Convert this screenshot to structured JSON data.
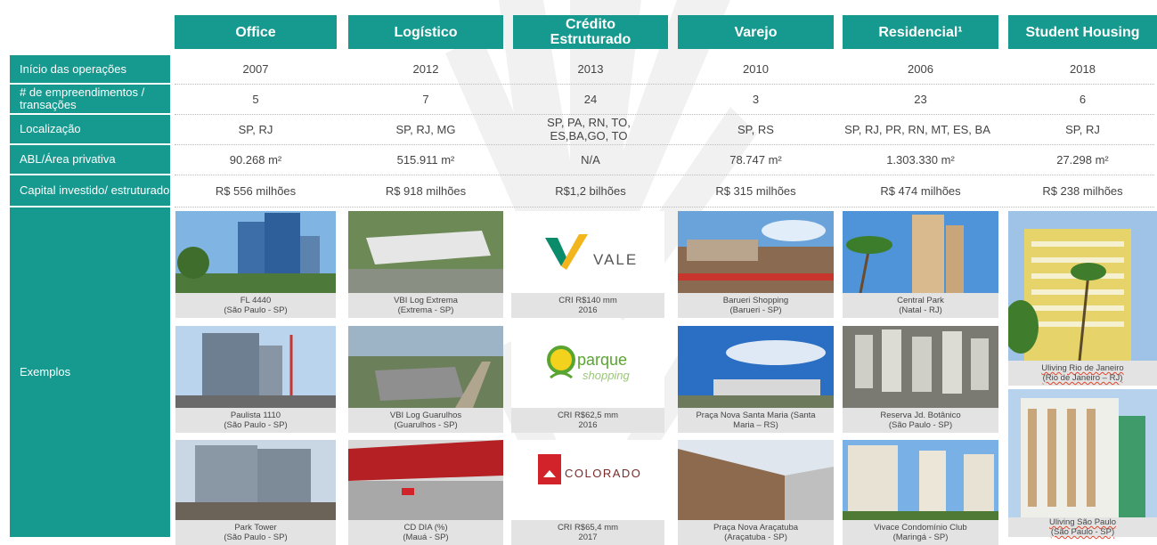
{
  "columns": [
    "Office",
    "Logístico",
    "Crédito Estruturado",
    "Varejo",
    "Residencial¹",
    "Student Housing"
  ],
  "rows": {
    "inicio": {
      "label": "Início das operações",
      "values": [
        "2007",
        "2012",
        "2013",
        "2010",
        "2006",
        "2018"
      ]
    },
    "empreendimentos": {
      "label": "# de empreendimentos / transações",
      "values": [
        "5",
        "7",
        "24",
        "3",
        "23",
        "6"
      ]
    },
    "localizacao": {
      "label": "Localização",
      "values": [
        "SP, RJ",
        "SP, RJ, MG",
        "SP, PA, RN, TO, ES,BA,GO, TO",
        "SP, RS",
        "SP, RJ, PR, RN, MT, ES, BA",
        "SP, RJ"
      ]
    },
    "abl": {
      "label": "ABL/Área privativa",
      "values": [
        "90.268 m²",
        "515.911 m²",
        "N/A",
        "78.747 m²",
        "1.303.330 m²",
        "27.298 m²"
      ]
    },
    "capital": {
      "label": "Capital investido/ estruturado",
      "values": [
        "R$ 556 milhões",
        "R$ 918 milhões",
        "R$1,2 bilhões",
        "R$ 315 milhões",
        "R$ 474 milhões",
        "R$ 238 milhões"
      ]
    },
    "exemplos": {
      "label": "Exemplos"
    }
  },
  "examples": {
    "office": [
      {
        "line1": "FL 4440",
        "line2": "(São Paulo - SP)"
      },
      {
        "line1": "Paulista 1110",
        "line2": "(São Paulo - SP)"
      },
      {
        "line1": "Park Tower",
        "line2": "(São Paulo - SP)"
      }
    ],
    "logistico": [
      {
        "line1": "VBI Log Extrema",
        "line2": "(Extrema  - SP)"
      },
      {
        "line1": "VBI Log Guarulhos",
        "line2": "(Guarulhos  - SP)"
      },
      {
        "line1": "CD DIA (%)",
        "line2": "(Mauá - SP)"
      }
    ],
    "credito": [
      {
        "line1": "CRI R$140 mm",
        "line2": "2016",
        "logo": "VALE"
      },
      {
        "line1": "CRI R$62,5 mm",
        "line2": "2016",
        "logo": "parque",
        "logo2": "shopping"
      },
      {
        "line1": "CRI R$65,4 mm",
        "line2": "2017",
        "logo": "COLORADO"
      }
    ],
    "varejo": [
      {
        "line1": "Barueri Shopping",
        "line2": "(Barueri - SP)"
      },
      {
        "line1": "Praça Nova Santa Maria (Santa",
        "line2": "Maria – RS)"
      },
      {
        "line1": "Praça Nova Araçatuba",
        "line2": "(Araçatuba - SP)"
      }
    ],
    "residencial": [
      {
        "line1": "Central Park",
        "line2": "(Natal - RJ)"
      },
      {
        "line1": "Reserva Jd. Botânico",
        "line2": "(São Paulo - SP)"
      },
      {
        "line1": "Vivace Condomínio Club",
        "line2": "(Maringá - SP)"
      }
    ],
    "student": [
      {
        "line1": "Uliving Rio de Janeiro",
        "line2": "(Rio de Janeiro – RJ)"
      },
      {
        "line1": "Uliving São Paulo",
        "line2": "(São Paulo - SP)"
      }
    ]
  },
  "colors": {
    "teal": "#16998e",
    "caption_bg": "#e3e3e3",
    "vale_green": "#0a8b6a",
    "vale_yellow": "#f2b61c",
    "parque_green": "#5aa531",
    "colorado_red": "#d3232a"
  }
}
